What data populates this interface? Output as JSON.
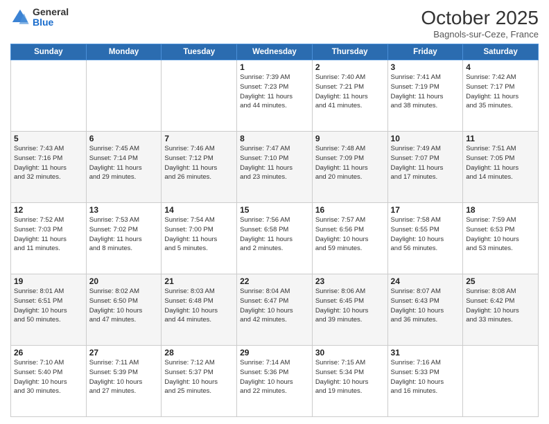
{
  "logo": {
    "general": "General",
    "blue": "Blue"
  },
  "header": {
    "month": "October 2025",
    "location": "Bagnols-sur-Ceze, France"
  },
  "weekdays": [
    "Sunday",
    "Monday",
    "Tuesday",
    "Wednesday",
    "Thursday",
    "Friday",
    "Saturday"
  ],
  "weeks": [
    [
      {
        "day": "",
        "info": ""
      },
      {
        "day": "",
        "info": ""
      },
      {
        "day": "",
        "info": ""
      },
      {
        "day": "1",
        "info": "Sunrise: 7:39 AM\nSunset: 7:23 PM\nDaylight: 11 hours\nand 44 minutes."
      },
      {
        "day": "2",
        "info": "Sunrise: 7:40 AM\nSunset: 7:21 PM\nDaylight: 11 hours\nand 41 minutes."
      },
      {
        "day": "3",
        "info": "Sunrise: 7:41 AM\nSunset: 7:19 PM\nDaylight: 11 hours\nand 38 minutes."
      },
      {
        "day": "4",
        "info": "Sunrise: 7:42 AM\nSunset: 7:17 PM\nDaylight: 11 hours\nand 35 minutes."
      }
    ],
    [
      {
        "day": "5",
        "info": "Sunrise: 7:43 AM\nSunset: 7:16 PM\nDaylight: 11 hours\nand 32 minutes."
      },
      {
        "day": "6",
        "info": "Sunrise: 7:45 AM\nSunset: 7:14 PM\nDaylight: 11 hours\nand 29 minutes."
      },
      {
        "day": "7",
        "info": "Sunrise: 7:46 AM\nSunset: 7:12 PM\nDaylight: 11 hours\nand 26 minutes."
      },
      {
        "day": "8",
        "info": "Sunrise: 7:47 AM\nSunset: 7:10 PM\nDaylight: 11 hours\nand 23 minutes."
      },
      {
        "day": "9",
        "info": "Sunrise: 7:48 AM\nSunset: 7:09 PM\nDaylight: 11 hours\nand 20 minutes."
      },
      {
        "day": "10",
        "info": "Sunrise: 7:49 AM\nSunset: 7:07 PM\nDaylight: 11 hours\nand 17 minutes."
      },
      {
        "day": "11",
        "info": "Sunrise: 7:51 AM\nSunset: 7:05 PM\nDaylight: 11 hours\nand 14 minutes."
      }
    ],
    [
      {
        "day": "12",
        "info": "Sunrise: 7:52 AM\nSunset: 7:03 PM\nDaylight: 11 hours\nand 11 minutes."
      },
      {
        "day": "13",
        "info": "Sunrise: 7:53 AM\nSunset: 7:02 PM\nDaylight: 11 hours\nand 8 minutes."
      },
      {
        "day": "14",
        "info": "Sunrise: 7:54 AM\nSunset: 7:00 PM\nDaylight: 11 hours\nand 5 minutes."
      },
      {
        "day": "15",
        "info": "Sunrise: 7:56 AM\nSunset: 6:58 PM\nDaylight: 11 hours\nand 2 minutes."
      },
      {
        "day": "16",
        "info": "Sunrise: 7:57 AM\nSunset: 6:56 PM\nDaylight: 10 hours\nand 59 minutes."
      },
      {
        "day": "17",
        "info": "Sunrise: 7:58 AM\nSunset: 6:55 PM\nDaylight: 10 hours\nand 56 minutes."
      },
      {
        "day": "18",
        "info": "Sunrise: 7:59 AM\nSunset: 6:53 PM\nDaylight: 10 hours\nand 53 minutes."
      }
    ],
    [
      {
        "day": "19",
        "info": "Sunrise: 8:01 AM\nSunset: 6:51 PM\nDaylight: 10 hours\nand 50 minutes."
      },
      {
        "day": "20",
        "info": "Sunrise: 8:02 AM\nSunset: 6:50 PM\nDaylight: 10 hours\nand 47 minutes."
      },
      {
        "day": "21",
        "info": "Sunrise: 8:03 AM\nSunset: 6:48 PM\nDaylight: 10 hours\nand 44 minutes."
      },
      {
        "day": "22",
        "info": "Sunrise: 8:04 AM\nSunset: 6:47 PM\nDaylight: 10 hours\nand 42 minutes."
      },
      {
        "day": "23",
        "info": "Sunrise: 8:06 AM\nSunset: 6:45 PM\nDaylight: 10 hours\nand 39 minutes."
      },
      {
        "day": "24",
        "info": "Sunrise: 8:07 AM\nSunset: 6:43 PM\nDaylight: 10 hours\nand 36 minutes."
      },
      {
        "day": "25",
        "info": "Sunrise: 8:08 AM\nSunset: 6:42 PM\nDaylight: 10 hours\nand 33 minutes."
      }
    ],
    [
      {
        "day": "26",
        "info": "Sunrise: 7:10 AM\nSunset: 5:40 PM\nDaylight: 10 hours\nand 30 minutes."
      },
      {
        "day": "27",
        "info": "Sunrise: 7:11 AM\nSunset: 5:39 PM\nDaylight: 10 hours\nand 27 minutes."
      },
      {
        "day": "28",
        "info": "Sunrise: 7:12 AM\nSunset: 5:37 PM\nDaylight: 10 hours\nand 25 minutes."
      },
      {
        "day": "29",
        "info": "Sunrise: 7:14 AM\nSunset: 5:36 PM\nDaylight: 10 hours\nand 22 minutes."
      },
      {
        "day": "30",
        "info": "Sunrise: 7:15 AM\nSunset: 5:34 PM\nDaylight: 10 hours\nand 19 minutes."
      },
      {
        "day": "31",
        "info": "Sunrise: 7:16 AM\nSunset: 5:33 PM\nDaylight: 10 hours\nand 16 minutes."
      },
      {
        "day": "",
        "info": ""
      }
    ]
  ]
}
